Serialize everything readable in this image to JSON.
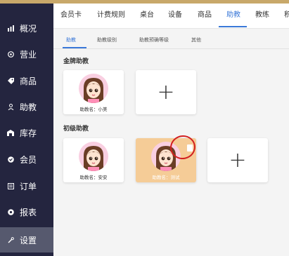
{
  "sidebar": {
    "items": [
      {
        "label": "概况",
        "icon": "bar-chart-icon"
      },
      {
        "label": "营业",
        "icon": "clock-icon"
      },
      {
        "label": "商品",
        "icon": "tag-icon"
      },
      {
        "label": "助教",
        "icon": "person-icon"
      },
      {
        "label": "库存",
        "icon": "warehouse-icon"
      },
      {
        "label": "会员",
        "icon": "member-icon"
      },
      {
        "label": "订单",
        "icon": "document-icon"
      },
      {
        "label": "报表",
        "icon": "report-icon"
      },
      {
        "label": "设置",
        "icon": "wrench-icon"
      }
    ],
    "active_item": "设置"
  },
  "header": {
    "tabs": [
      {
        "label": "会员卡"
      },
      {
        "label": "计费规则"
      },
      {
        "label": "桌台"
      },
      {
        "label": "设备"
      },
      {
        "label": "商品"
      },
      {
        "label": "助教"
      },
      {
        "label": "教练"
      },
      {
        "label": "积"
      }
    ],
    "active_tab": "助教"
  },
  "subtabs": {
    "items": [
      {
        "label": "助教"
      },
      {
        "label": "助教级别"
      },
      {
        "label": "助教预确等级"
      },
      {
        "label": "其他"
      }
    ],
    "active": "助教"
  },
  "sections": {
    "gold": {
      "title": "金牌助教",
      "coaches": [
        {
          "label": "助教名：小美"
        }
      ]
    },
    "junior": {
      "title": "初级助教",
      "coaches": [
        {
          "label": "助教名：安安"
        },
        {
          "label": "助教名：测试"
        }
      ]
    }
  },
  "add_symbol": "+",
  "colors": {
    "sidebar_bg": "#24253f",
    "accent_gold": "#c8a86a",
    "active_blue": "#3a78d8",
    "selected_card": "#f5cc97",
    "annotation_red": "#d21f1f"
  }
}
